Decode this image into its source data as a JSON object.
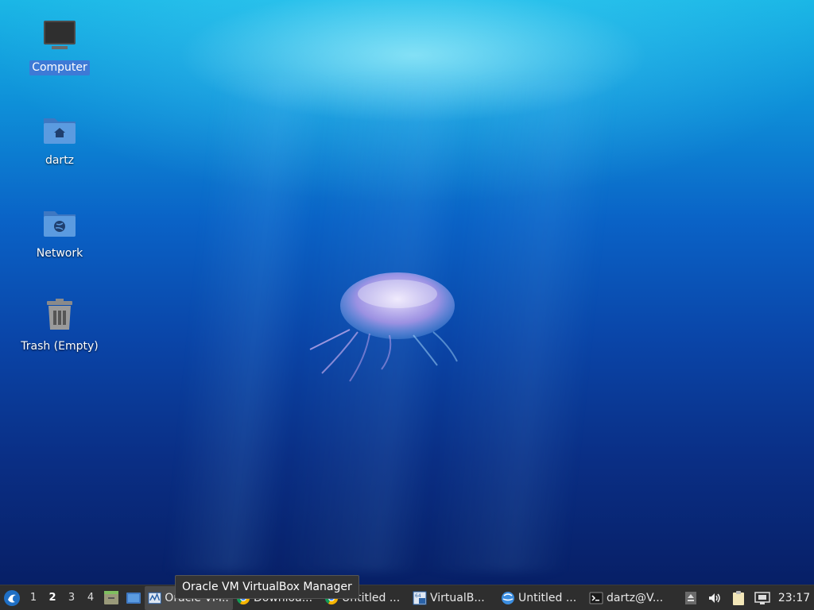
{
  "desktop": {
    "icons": [
      {
        "label": "Computer"
      },
      {
        "label": "dartz"
      },
      {
        "label": "Network"
      },
      {
        "label": "Trash (Empty)"
      }
    ]
  },
  "tooltip": "Oracle VM VirtualBox Manager",
  "panel": {
    "workspaces": [
      "1",
      "2",
      "3",
      "4"
    ],
    "tasks": [
      {
        "label": "Oracle VM...",
        "icon": "virtualbox-icon"
      },
      {
        "label": "Downloa...",
        "icon": "chrome-icon"
      },
      {
        "label": "Untitled ...",
        "icon": "chrome-icon"
      },
      {
        "label": "VirtualB...",
        "icon": "virtualbox-vm-icon"
      },
      {
        "label": "Untitled ...",
        "icon": "browser-icon"
      },
      {
        "label": "dartz@V...",
        "icon": "terminal-icon"
      }
    ],
    "clock": "23:17"
  }
}
